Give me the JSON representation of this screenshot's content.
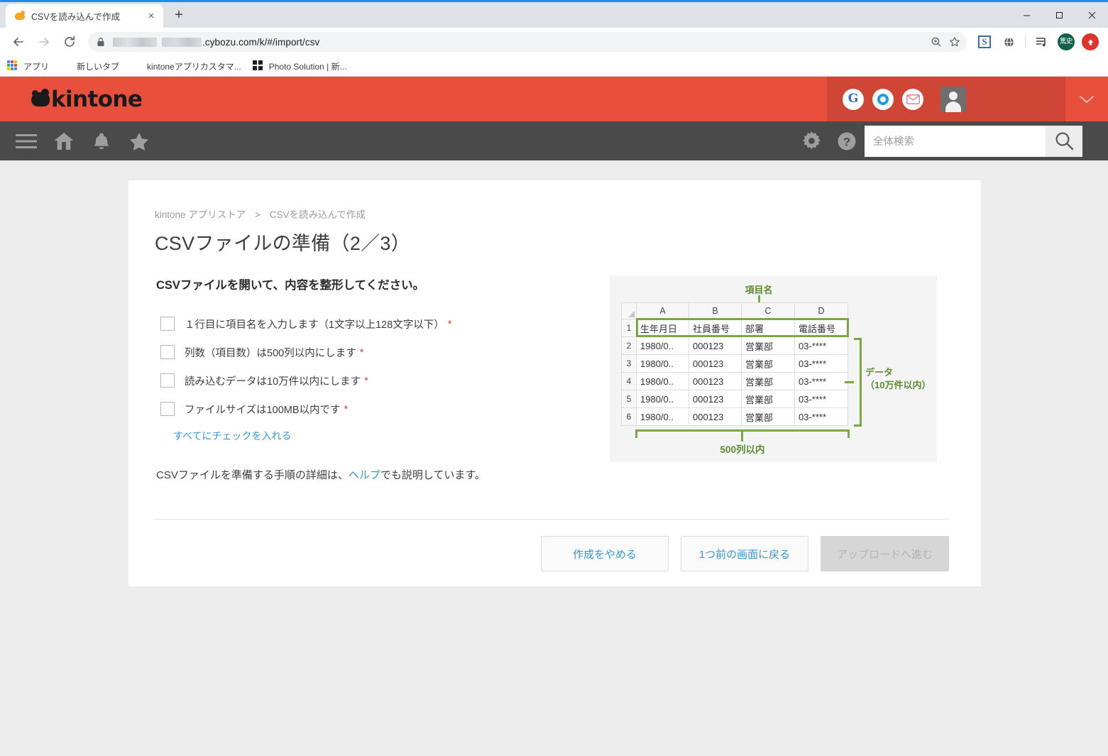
{
  "browser": {
    "tab": {
      "title": "CSVを読み込んで作成",
      "favicon": "kintone-cloud-icon",
      "close": "×"
    },
    "new_tab_label": "+",
    "window_controls": {
      "minimize": "minimize-icon",
      "maximize": "maximize-icon",
      "close": "close-icon"
    },
    "nav": {
      "back": "back-arrow-icon",
      "forward": "forward-arrow-icon",
      "reload": "reload-icon"
    },
    "address": {
      "lock": "lock-icon",
      "url_suffix": ".cybozu.com/k/#/import/csv",
      "zoom_icon": "zoom-magnifier-icon",
      "bookmark_icon": "star-icon"
    },
    "extensions": [
      {
        "name": "s-extension-icon",
        "label": "S"
      },
      {
        "name": "globe-extension-icon",
        "label": ""
      },
      {
        "name": "playlist-extension-icon",
        "label": ""
      },
      {
        "name": "profile-avatar",
        "label": "篤史"
      },
      {
        "name": "update-extension-icon",
        "label": ""
      }
    ],
    "bookmarks": [
      {
        "icon": "apps-grid-icon",
        "label": "アプリ"
      },
      {
        "icon": "globe-icon",
        "label": "新しいタブ"
      },
      {
        "icon": "globe-icon",
        "label": "kintoneアプリカスタマ..."
      },
      {
        "icon": "squares-icon",
        "label": "Photo Solution | 新..."
      }
    ]
  },
  "kintone": {
    "logo_text": "kintone",
    "header_apps": [
      {
        "name": "google-app-icon",
        "label": "G"
      },
      {
        "name": "office-app-icon",
        "label": ""
      },
      {
        "name": "mail-app-icon",
        "label": ""
      }
    ],
    "avatar": "user-avatar",
    "chevron": "chevron-down-icon",
    "nav_icons": [
      {
        "name": "hamburger-menu-icon"
      },
      {
        "name": "home-icon"
      },
      {
        "name": "notification-bell-icon"
      },
      {
        "name": "favorites-star-icon"
      },
      {
        "name": "gear-icon"
      },
      {
        "name": "help-icon"
      }
    ],
    "search": {
      "placeholder": "全体検索",
      "value": "",
      "button_icon": "search-icon"
    }
  },
  "main": {
    "breadcrumb": {
      "root": "kintone アプリストア",
      "separator": ">",
      "current": "CSVを読み込んで作成"
    },
    "title": "CSVファイルの準備（2／3）",
    "lead": "CSVファイルを開いて、内容を整形してください。",
    "checklist": [
      {
        "label": "１行目に項目名を入力します（1文字以上128文字以下）",
        "required": "*",
        "checked": false
      },
      {
        "label": "列数（項目数）は500列以内にします",
        "required": "*",
        "checked": false
      },
      {
        "label": "読み込むデータは10万件以内にします",
        "required": "*",
        "checked": false
      },
      {
        "label": "ファイルサイズは100MB以内です",
        "required": "*",
        "checked": false
      }
    ],
    "check_all_label": "すべてにチェックを入れる",
    "help_text_before": "CSVファイルを準備する手順の詳細は、",
    "help_link": "ヘルプ",
    "help_text_after": "でも説明しています。",
    "buttons": [
      {
        "label": "作成をやめる",
        "disabled": false
      },
      {
        "label": "1つ前の画面に戻る",
        "disabled": false
      },
      {
        "label": "アップロードへ進む",
        "disabled": true
      }
    ]
  },
  "illustration": {
    "annotation_header": "項目名",
    "annotation_data_line1": "データ",
    "annotation_data_line2": "（10万件以内）",
    "annotation_columns": "500列以内",
    "accent_color": "#79a845",
    "accent_text_color": "#5e8c32",
    "column_headers": [
      "A",
      "B",
      "C",
      "D"
    ],
    "row_numbers": [
      "1",
      "2",
      "3",
      "4",
      "5",
      "6"
    ],
    "rows": [
      [
        "生年月日",
        "社員番号",
        "部署",
        "電話番号"
      ],
      [
        "1980/0..",
        "000123",
        "営業部",
        "03-****"
      ],
      [
        "1980/0..",
        "000123",
        "営業部",
        "03-****"
      ],
      [
        "1980/0..",
        "000123",
        "営業部",
        "03-****"
      ],
      [
        "1980/0..",
        "000123",
        "営業部",
        "03-****"
      ],
      [
        "1980/0..",
        "000123",
        "営業部",
        "03-****"
      ]
    ]
  }
}
